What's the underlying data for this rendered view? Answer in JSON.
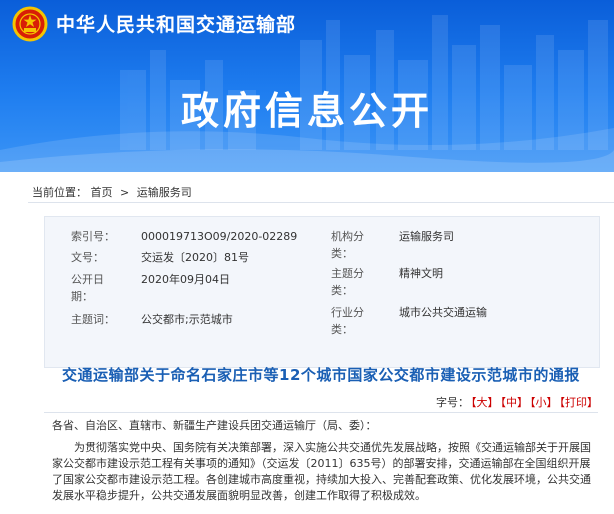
{
  "header": {
    "site_name": "中华人民共和国交通运输部",
    "banner_title": "政府信息公开",
    "emblem_icon": "national-emblem-icon",
    "colors": {
      "banner_top": "#0a5ed9",
      "banner_bottom": "#3c95f6",
      "title_blue": "#1a5fb4",
      "font_btn_red": "#cc0000"
    }
  },
  "breadcrumb": {
    "label": "当前位置：",
    "items": [
      "首页",
      "运输服务司"
    ],
    "separator": ">"
  },
  "meta": {
    "index_label": "索引号：",
    "index_value": "000019713O09/2020-02289",
    "doc_no_label": "文号：",
    "doc_no_value": "交运发〔2020〕81号",
    "date_label_1": "公开日",
    "date_label_2": "期：",
    "date_value": "2020年09月04日",
    "subject_label": "主题词：",
    "subject_value": "公交都市;示范城市",
    "org_label_1": "机构分",
    "org_label_2": "类：",
    "org_value": "运输服务司",
    "topic_label_1": "主题分",
    "topic_label_2": "类：",
    "topic_value": "精神文明",
    "industry_label_1": "行业分",
    "industry_label_2": "类：",
    "industry_value": "城市公共交通运输"
  },
  "document": {
    "title": "交通运输部关于命名石家庄市等12个城市国家公交都市建设示范城市的通报",
    "font_size_label": "字号：",
    "font_large": "【大】",
    "font_medium": "【中】",
    "font_small": "【小】",
    "print": "【打印】",
    "salutation": "各省、自治区、直辖市、新疆生产建设兵团交通运输厅（局、委）：",
    "paragraph_lines": [
      "为贯彻落实党中央、国务院有关决策部署，深入实施公共交通优先发展战略，按照《交通运",
      "输部关于开展国家公交都市建设示范工程有关事项的通知》（交运发〔2011〕635号）的部署安",
      "排，交通运输部在全国组织开展了国家公交都市建设示范工程。各创建城市高度重视，持续加大",
      "投入、完善配套政策、优化发展环境，公共交通发展水平稳步提升，公共交通发展面貌明显改",
      "善，创建工作取得了积极成效。"
    ]
  }
}
